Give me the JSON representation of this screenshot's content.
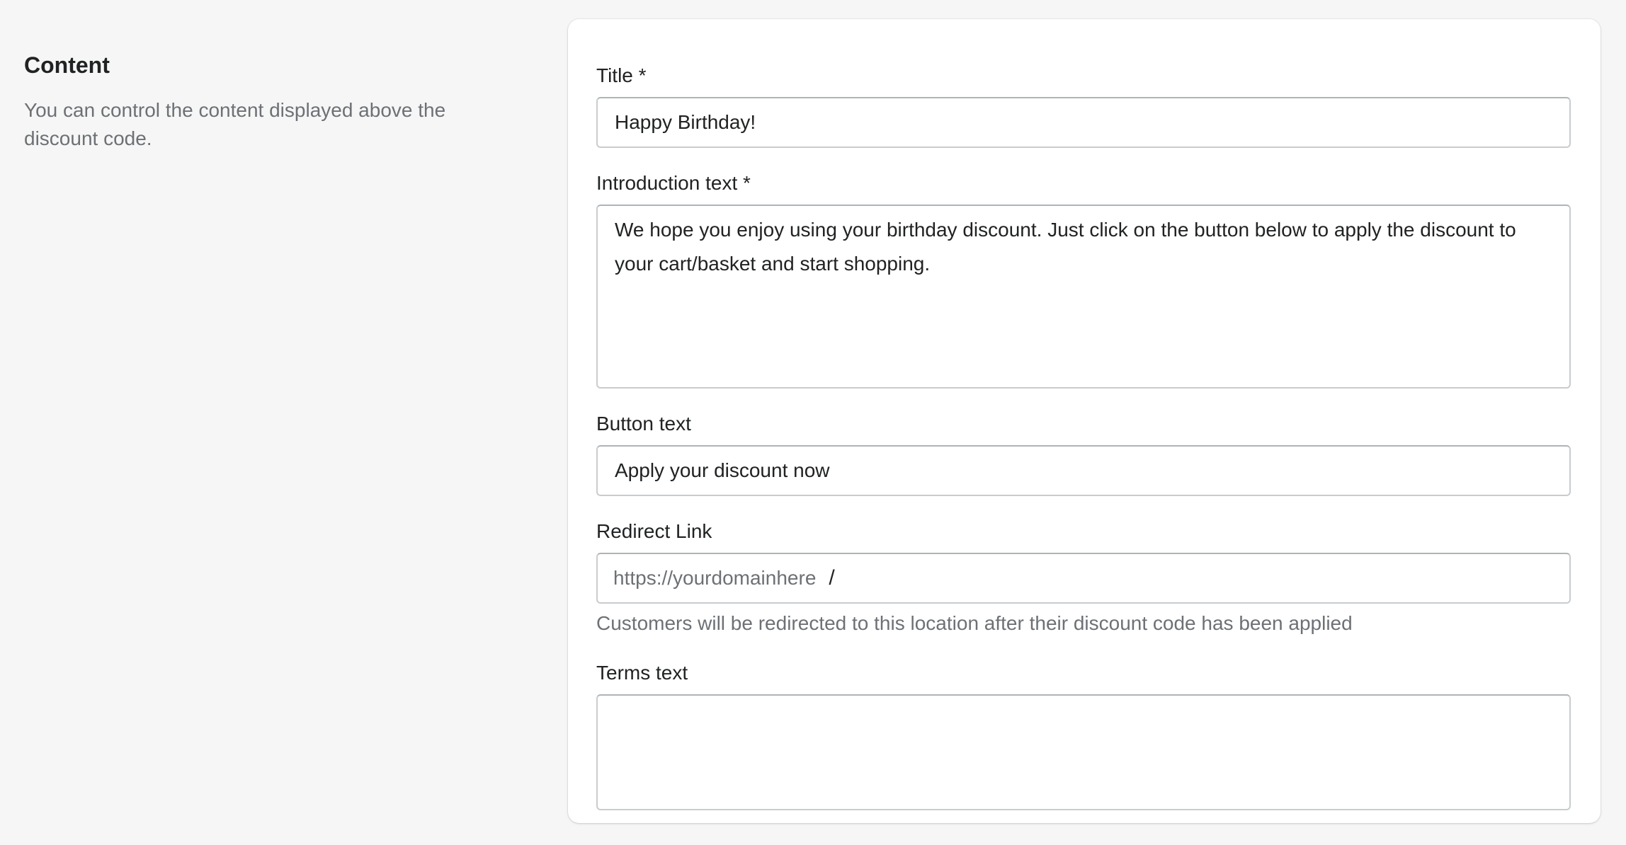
{
  "section": {
    "title": "Content",
    "description": "You can control the content displayed above the discount code."
  },
  "form": {
    "title_field": {
      "label": "Title *",
      "value": "Happy Birthday!"
    },
    "intro_field": {
      "label": "Introduction text *",
      "value": "We hope you enjoy using your birthday discount. Just click on the button below to apply the discount to your cart/basket and start shopping."
    },
    "button_field": {
      "label": "Button text",
      "value": "Apply your discount now"
    },
    "redirect_field": {
      "label": "Redirect Link",
      "prefix": "https://yourdomainhere",
      "separator": "/",
      "value": "",
      "help": "Customers will be redirected to this location after their discount code has been applied"
    },
    "terms_field": {
      "label": "Terms text",
      "value": ""
    }
  }
}
